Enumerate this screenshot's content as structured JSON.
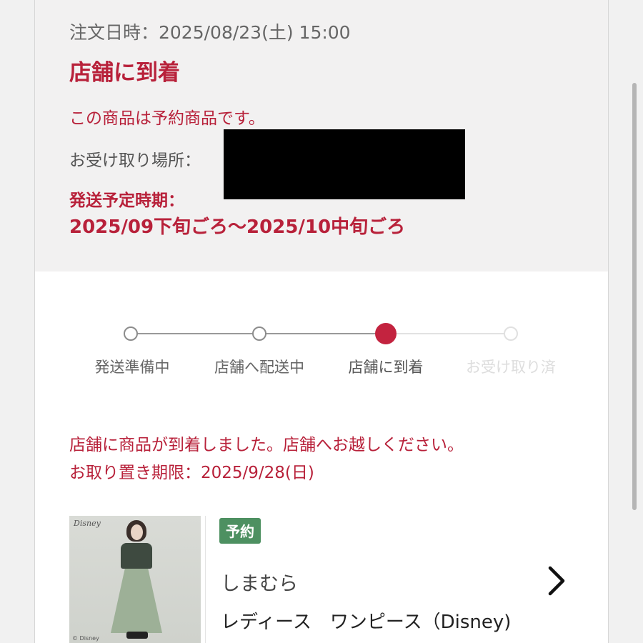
{
  "order": {
    "date_label": "注文日時：2025/08/23(土) 15:00",
    "status_title": "店舗に到着",
    "reserve_note": "この商品は予約商品です。",
    "pickup_label": "お受け取り場所：",
    "ship_label": "発送予定時期：",
    "ship_period": "2025/09下旬ごろ〜2025/10中旬ごろ"
  },
  "progress": {
    "current_step": 3,
    "steps": [
      {
        "label": "発送準備中",
        "state": "done"
      },
      {
        "label": "店舗へ配送中",
        "state": "done"
      },
      {
        "label": "店舗に到着",
        "state": "current"
      },
      {
        "label": "お受け取り済",
        "state": "todo"
      }
    ]
  },
  "notice": {
    "arrival_message": "店舗に商品が到着しました。店舗へお越しください。",
    "pickup_deadline": "お取り置き期限：2025/9/28(日)"
  },
  "product": {
    "badge": "予約",
    "brand": "しまむら",
    "name": "レディース　ワンピース（Disney)",
    "thumbnail_brand": "Disney",
    "thumbnail_copyright": "© Disney"
  },
  "colors": {
    "accent_red": "#b8213a",
    "badge_green": "#4d9061",
    "summary_bg": "#f2f1f1"
  },
  "icons": [
    "chevron-right-icon",
    "step-dot-icon"
  ]
}
